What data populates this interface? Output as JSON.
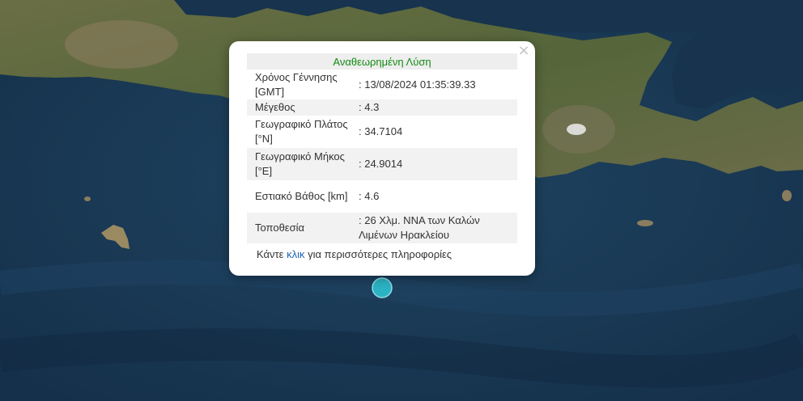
{
  "popup": {
    "title": "Αναθεωρημένη Λύση",
    "close": "×",
    "rows": [
      {
        "label": "Χρόνος Γέννησης [GMT]",
        "value": ": 13/08/2024 01:35:39.33"
      },
      {
        "label": "Μέγεθος",
        "value": ": 4.3"
      },
      {
        "label": "Γεωγραφικό Πλάτος [°N]",
        "value": ": 34.7104"
      },
      {
        "label": "Γεωγραφικό Μήκος [°E]",
        "value": ": 24.9014"
      },
      {
        "label": "Εστιακό Βάθος [km]",
        "value": ": 4.6"
      },
      {
        "label": "Τοποθεσία",
        "value": ": 26 Χλμ. ΝΝΑ των Καλών Λιμένων Ηρακλείου"
      }
    ],
    "footer_before": "Κάντε ",
    "footer_link": "κλικ",
    "footer_after": " για περισσότερες πληροφορίες"
  },
  "colors": {
    "sea": "#1b3a55",
    "land": "#5a6a3a",
    "marker": "#2bb3c4",
    "title_green": "#138a13",
    "link_blue": "#1d64b4"
  }
}
